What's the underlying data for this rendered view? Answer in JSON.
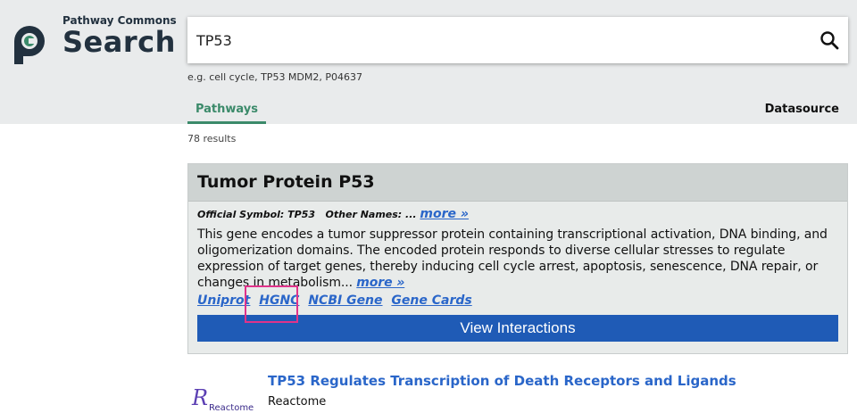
{
  "app": {
    "brand_small": "Pathway Commons",
    "brand_big": "Search"
  },
  "search": {
    "value": "TP53",
    "example": "e.g. cell cycle, TP53 MDM2, P04637"
  },
  "tabs": {
    "pathways": "Pathways",
    "datasource": "Datasource"
  },
  "results_count": "78 results",
  "gene_card": {
    "title": "Tumor Protein P53",
    "official_symbol": "Official Symbol: TP53",
    "other_names": "Other Names: ...",
    "more1": "more »",
    "description": "This gene encodes a tumor suppressor protein containing transcriptional activation, DNA binding, and oligomerization domains. The encoded protein responds to diverse cellular stresses to regulate expression of target genes, thereby inducing cell cycle arrest, apoptosis, senescence, DNA repair, or changes in metabolism...",
    "more2": "more »",
    "links": [
      "Uniprot",
      "HGNC",
      "NCBI Gene",
      "Gene Cards"
    ],
    "view_button": "View Interactions"
  },
  "result": {
    "logo_text": "Reactome",
    "title": "TP53 Regulates Transcription of Death Receptors and Ligands",
    "source": "Reactome"
  },
  "colors": {
    "accent_green": "#3b8a6a",
    "link_blue": "#2a66c9",
    "button_blue": "#1f5bb6",
    "highlight": "#e0338a"
  },
  "icons": {
    "logo": "pathway-commons-logo",
    "search": "search-icon"
  }
}
